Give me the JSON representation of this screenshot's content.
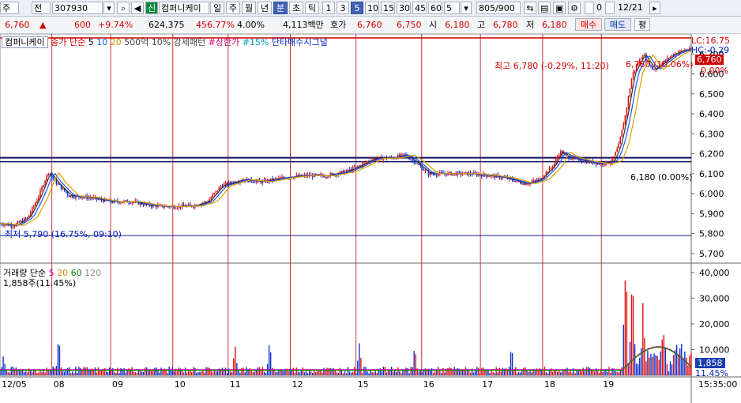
{
  "toolbar": {
    "market": "주",
    "prev_label": "전",
    "code": "307930",
    "sin_badge": "신",
    "stock_name": "컴퍼니케이",
    "periods": [
      "일",
      "주",
      "월",
      "년",
      "분",
      "초",
      "틱"
    ],
    "active_period": "분",
    "intervals": [
      "1",
      "3",
      "5",
      "10",
      "15",
      "30",
      "45",
      "60"
    ],
    "active_interval": "5",
    "interval_select": "5",
    "count": "805",
    "count_total": "/900",
    "checkbox_value": "0",
    "date": "12/21"
  },
  "info": {
    "price": "6,760",
    "change": "600",
    "change_pct": "+9.74%",
    "volume": "624,375",
    "volume_pct": "456.77%",
    "turnover": "4.00%",
    "amount": "4,113백만",
    "hoga_label": "호가",
    "ask": "6,760",
    "bid": "6,750",
    "open_label": "시",
    "open": "6,180",
    "high_label": "고",
    "high": "6,780",
    "low_label": "저",
    "low": "6,180",
    "buy_label": "매수",
    "sell_label": "매도",
    "eval_label": "평"
  },
  "legend": {
    "name": "컴퍼니케이",
    "close_label": "종가 단순",
    "ma": [
      "5",
      "10",
      "20"
    ],
    "volume_item": "500억 10% 강세패턴",
    "upper_limit": "#상한가",
    "pct15": "#15%",
    "signal": "단타매수시그널",
    "lc": "LC:16.75",
    "hc": "HC:-0.29",
    "price_tag": "6,760",
    "pct_tag": "0.00%",
    "high_annot": "최고 6,780 (-0.29%, 11:20)",
    "close_annot": "6,780 (10.06%)",
    "low_annot": "최저 5,790 (16.75%, 09:10)",
    "open_annot": "6,180 (0.00%)",
    "vol_title": "거래량 단순",
    "vol_ma": [
      "5",
      "20",
      "60",
      "120"
    ],
    "vol_current": "1,858주(11.45%)",
    "vol_tag": "1,858",
    "vol_pct_tag": "11.45%",
    "time_tag": "15:35:00"
  },
  "chart_data": {
    "type": "candlestick",
    "interval": "5 minute",
    "x_labels": [
      "12/05",
      "08",
      "09",
      "10",
      "11",
      "12",
      "15",
      "16",
      "17",
      "18",
      "19"
    ],
    "price_axis": [
      "6,700",
      "6,600",
      "6,500",
      "6,400",
      "6,300",
      "6,200",
      "6,100",
      "6,000",
      "5,900",
      "5,800",
      "5,700"
    ],
    "price_range": [
      5660,
      6800
    ],
    "volume_axis": [
      "40,000",
      "30,000",
      "20,000",
      "10,000"
    ],
    "volume_range": [
      0,
      43000
    ],
    "horizontal_lines": [
      6780,
      6180,
      6160,
      5790
    ],
    "close_path": [
      [
        0,
        5850
      ],
      [
        0.02,
        5840
      ],
      [
        0.04,
        5880
      ],
      [
        0.055,
        5980
      ],
      [
        0.07,
        6110
      ],
      [
        0.08,
        6060
      ],
      [
        0.1,
        5990
      ],
      [
        0.13,
        5980
      ],
      [
        0.16,
        5960
      ],
      [
        0.19,
        5960
      ],
      [
        0.22,
        5940
      ],
      [
        0.25,
        5935
      ],
      [
        0.28,
        5940
      ],
      [
        0.3,
        5960
      ],
      [
        0.32,
        6040
      ],
      [
        0.35,
        6070
      ],
      [
        0.38,
        6060
      ],
      [
        0.41,
        6080
      ],
      [
        0.44,
        6090
      ],
      [
        0.47,
        6090
      ],
      [
        0.5,
        6110
      ],
      [
        0.52,
        6140
      ],
      [
        0.54,
        6175
      ],
      [
        0.57,
        6180
      ],
      [
        0.585,
        6195
      ],
      [
        0.6,
        6160
      ],
      [
        0.62,
        6100
      ],
      [
        0.65,
        6100
      ],
      [
        0.68,
        6100
      ],
      [
        0.71,
        6090
      ],
      [
        0.73,
        6080
      ],
      [
        0.76,
        6050
      ],
      [
        0.78,
        6070
      ],
      [
        0.8,
        6140
      ],
      [
        0.81,
        6210
      ],
      [
        0.825,
        6180
      ],
      [
        0.85,
        6160
      ],
      [
        0.87,
        6150
      ],
      [
        0.885,
        6160
      ],
      [
        0.895,
        6240
      ],
      [
        0.905,
        6400
      ],
      [
        0.915,
        6600
      ],
      [
        0.93,
        6700
      ],
      [
        0.945,
        6620
      ],
      [
        0.96,
        6660
      ],
      [
        0.975,
        6700
      ],
      [
        0.99,
        6720
      ]
    ],
    "volume_spikes": [
      [
        0.005,
        8000
      ],
      [
        0.085,
        16000
      ],
      [
        0.34,
        12000
      ],
      [
        0.39,
        14000
      ],
      [
        0.52,
        13000
      ],
      [
        0.6,
        12000
      ],
      [
        0.74,
        12000
      ],
      [
        0.905,
        41000
      ],
      [
        0.915,
        37000
      ],
      [
        0.93,
        20000
      ],
      [
        0.96,
        10000
      ],
      [
        0.985,
        9000
      ]
    ]
  }
}
